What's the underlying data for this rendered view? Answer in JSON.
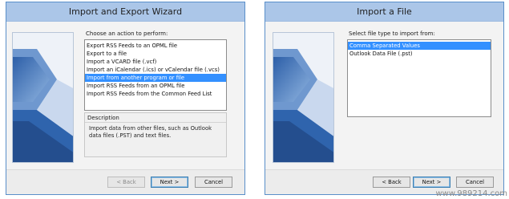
{
  "wizard1": {
    "title": "Import and Export Wizard",
    "prompt": "Choose an action to perform:",
    "actions": [
      "Export RSS Feeds to an OPML file",
      "Export to a file",
      "Import a VCARD file (.vcf)",
      "Import an iCalendar (.ics) or vCalendar file (.vcs)",
      "Import from another program or file",
      "Import RSS Feeds from an OPML file",
      "Import RSS Feeds from the Common Feed List"
    ],
    "selected_action": "Import from another program or file",
    "description_title": "Description",
    "description_text": "Import data from other files, such as Outlook data files (.PST) and text files.",
    "back_label": "< Back",
    "next_label": "Next >",
    "cancel_label": "Cancel"
  },
  "wizard2": {
    "title": "Import a File",
    "prompt": "Select file type to import from:",
    "file_types": [
      "Comma Separated Values",
      "Outlook Data File (.pst)"
    ],
    "selected_file_type": "Comma Separated Values",
    "back_label": "< Back",
    "next_label": "Next >",
    "cancel_label": "Cancel"
  },
  "watermark": "www.989214.com",
  "colors": {
    "titlebar": "#abc6e8",
    "selection": "#3390ff",
    "border": "#5a8fc9"
  }
}
